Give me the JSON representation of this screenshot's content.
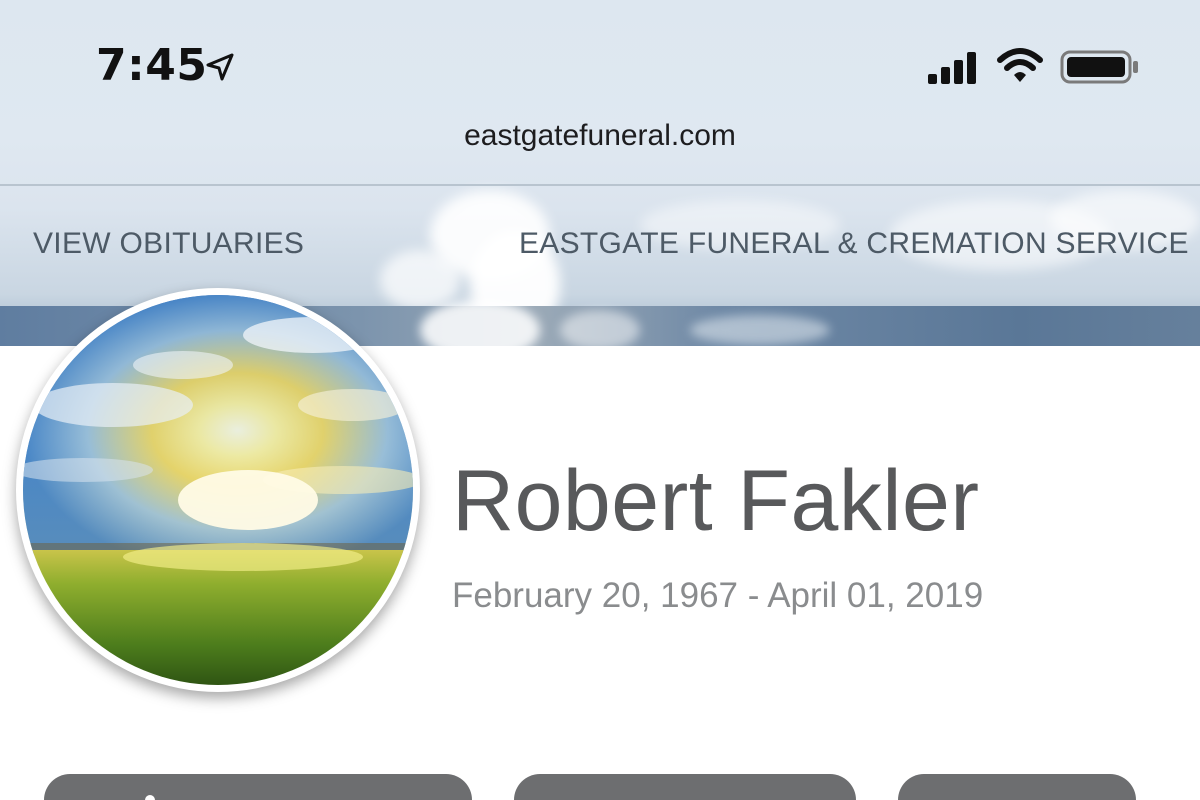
{
  "status_bar": {
    "time": "7:45"
  },
  "browser": {
    "url": "eastgatefuneral.com"
  },
  "nav": {
    "view_obituaries": "VIEW OBITUARIES",
    "brand": "EASTGATE FUNERAL & CREMATION SERVICE"
  },
  "obituary": {
    "name": "Robert Fakler",
    "dates": "February 20, 1967 - April 01, 2019"
  },
  "icons": {
    "location": "location-arrow-icon",
    "signal": "cellular-signal-icon",
    "wifi": "wifi-icon",
    "battery": "battery-icon",
    "share": "share-icon"
  },
  "colors": {
    "name_text": "#58595b",
    "dates_text": "#8a8c8e",
    "nav_text": "#4d5a66",
    "button_bg": "#6d6e70"
  }
}
